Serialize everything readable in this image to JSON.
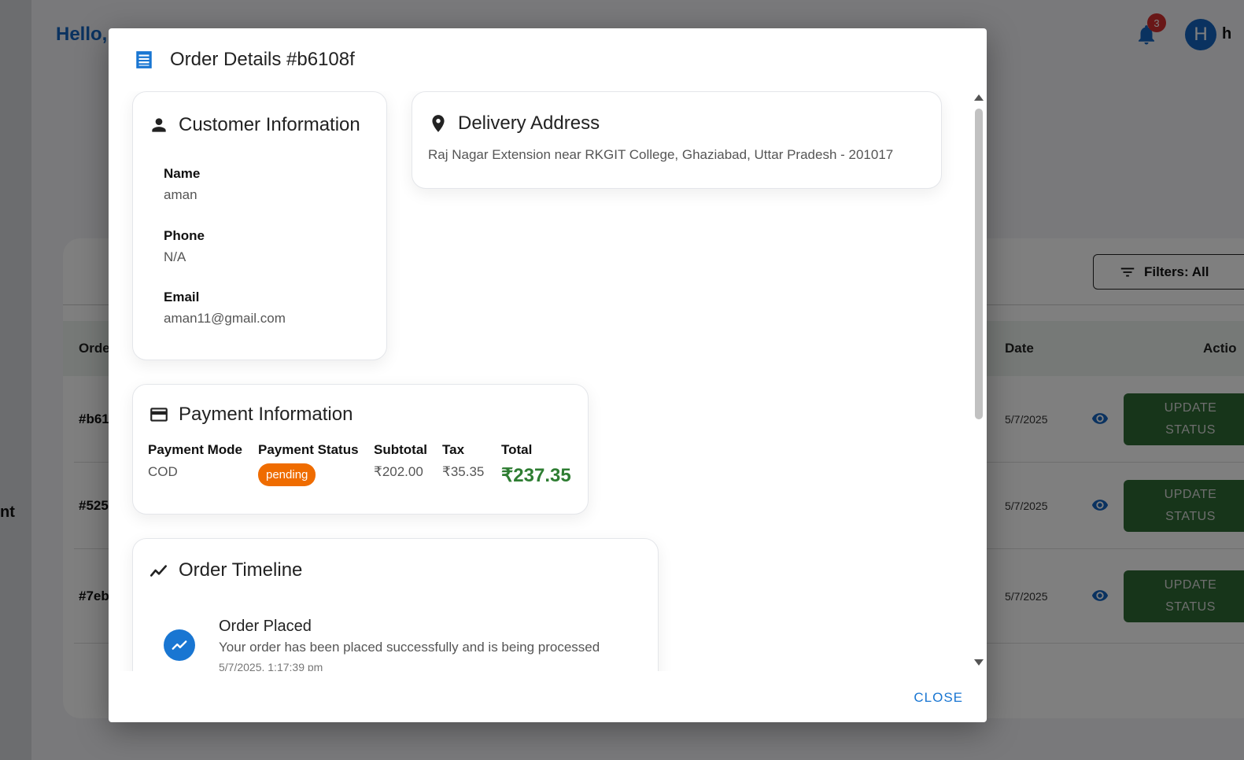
{
  "background": {
    "greeting": "Hello,",
    "sidebar_fragment": "nt",
    "notification_count": "3",
    "avatar_initial": "H",
    "user_fragment": "h",
    "filter_label": "Filters: All",
    "table_headers": {
      "order": "Orde",
      "date": "Date",
      "action": "Actio"
    },
    "rows": [
      {
        "order": "#b61",
        "date": "5/7/2025",
        "action_label": "UPDATE STATUS"
      },
      {
        "order": "#525",
        "date": "5/7/2025",
        "action_label": "UPDATE STATUS"
      },
      {
        "order": "#7eb",
        "date": "5/7/2025",
        "action_label": "UPDATE STATUS"
      }
    ]
  },
  "dialog": {
    "title": "Order Details #b6108f",
    "customer": {
      "title": "Customer Information",
      "name_label": "Name",
      "name": "aman",
      "phone_label": "Phone",
      "phone": "N/A",
      "email_label": "Email",
      "email": "aman11@gmail.com"
    },
    "delivery": {
      "title": "Delivery Address",
      "address": "Raj Nagar Extension near RKGIT College, Ghaziabad, Uttar Pradesh - 201017"
    },
    "payment": {
      "title": "Payment Information",
      "mode_label": "Payment Mode",
      "mode": "COD",
      "status_label": "Payment Status",
      "status": "pending",
      "status_color": "#ef6c00",
      "subtotal_label": "Subtotal",
      "subtotal": "₹202.00",
      "tax_label": "Tax",
      "tax": "₹35.35",
      "total_label": "Total",
      "total": "₹237.35",
      "total_color": "#2e7d32"
    },
    "timeline": {
      "title": "Order Timeline",
      "events": [
        {
          "title": "Order Placed",
          "description": "Your order has been placed successfully and is being processed",
          "time": "5/7/2025, 1:17:39 pm"
        }
      ]
    },
    "close_label": "CLOSE"
  },
  "colors": {
    "primary": "#1976d2",
    "brand_dark": "#1565c0",
    "action_green": "#2e6b34",
    "badge_red": "#d32f2f"
  }
}
